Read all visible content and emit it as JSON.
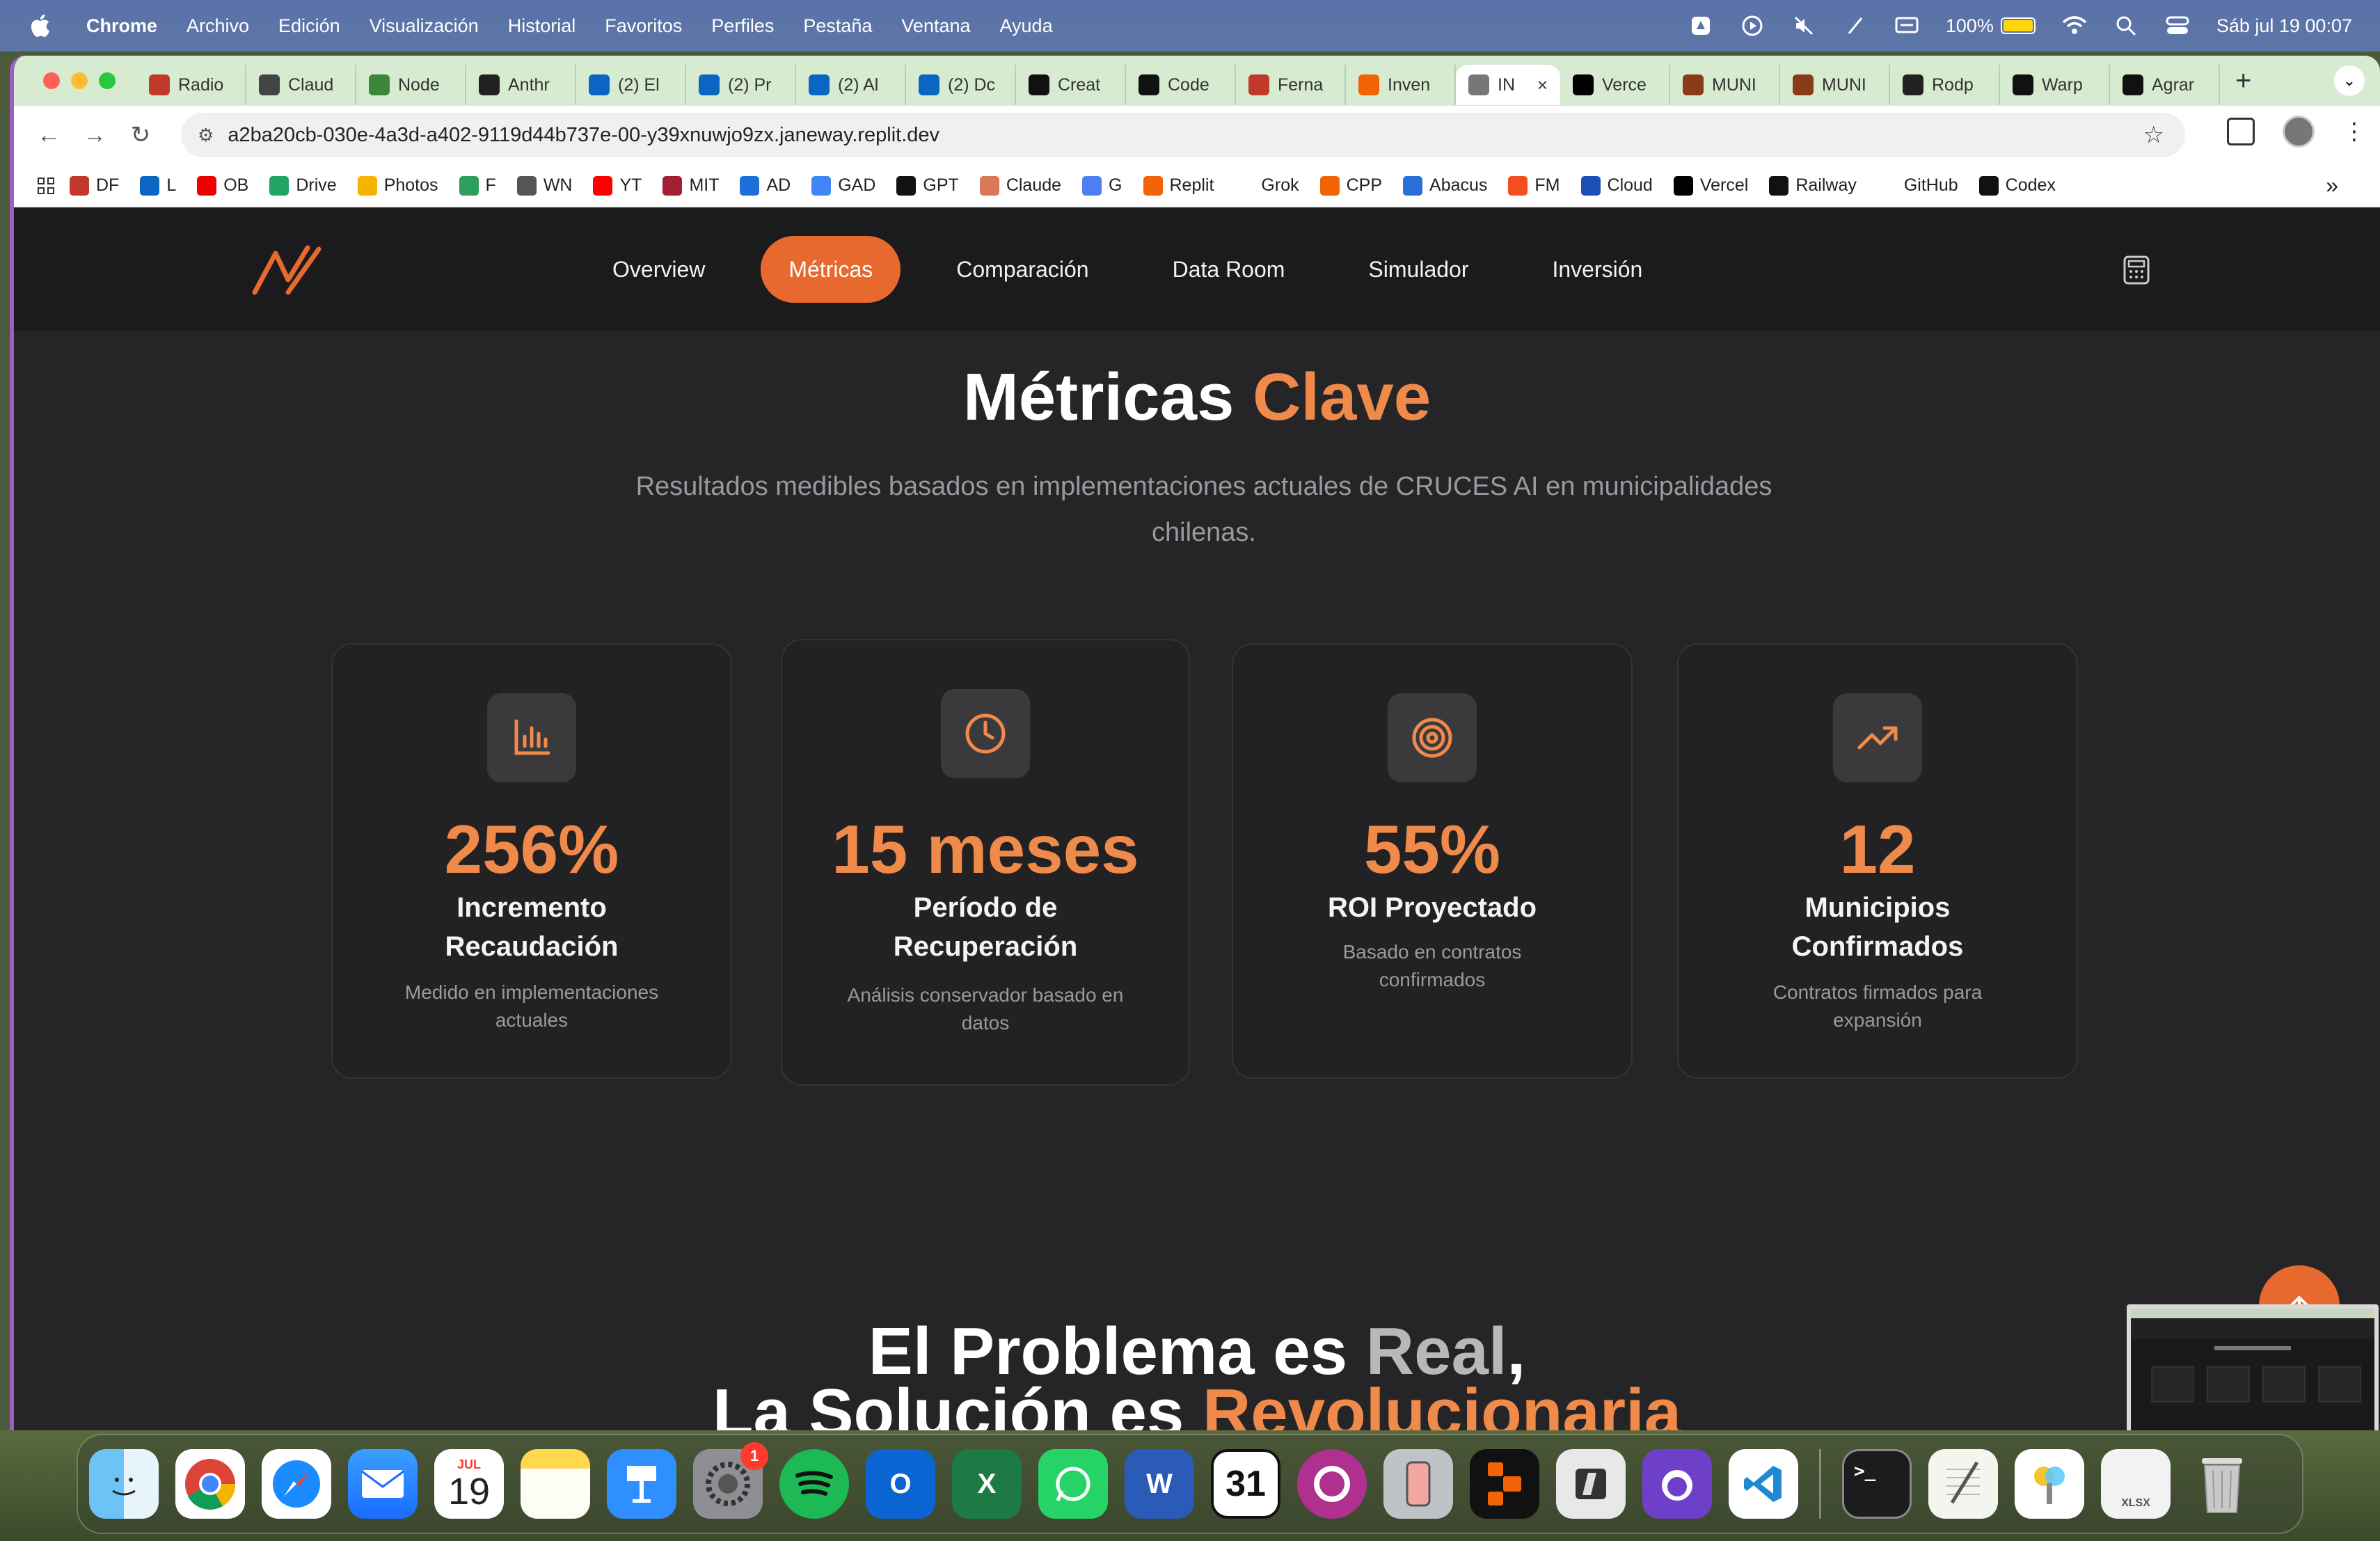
{
  "menubar": {
    "app": "Chrome",
    "items": [
      "Archivo",
      "Edición",
      "Visualización",
      "Historial",
      "Favoritos",
      "Perfiles",
      "Pestaña",
      "Ventana",
      "Ayuda"
    ],
    "battery": "100%",
    "datetime": "Sáb jul 19  00:07"
  },
  "tabs": [
    {
      "label": "Radio",
      "icon": "df-icon",
      "color": "#c0392b"
    },
    {
      "label": "Claud",
      "icon": "anthropic-icon",
      "color": "#444444"
    },
    {
      "label": "Node",
      "icon": "node-icon",
      "color": "#3c873a"
    },
    {
      "label": "Anthr",
      "icon": "anthropic-icon",
      "color": "#222222"
    },
    {
      "label": "(2) El",
      "icon": "linkedin-icon",
      "color": "#0a66c2"
    },
    {
      "label": "(2) Pr",
      "icon": "linkedin-icon",
      "color": "#0a66c2"
    },
    {
      "label": "(2) Al",
      "icon": "linkedin-icon",
      "color": "#0a66c2"
    },
    {
      "label": "(2) Dc",
      "icon": "linkedin-icon",
      "color": "#0a66c2"
    },
    {
      "label": "Creat",
      "icon": "v0-icon",
      "color": "#111111"
    },
    {
      "label": "Code",
      "icon": "openai-icon",
      "color": "#111111"
    },
    {
      "label": "Ferna",
      "icon": "df-icon",
      "color": "#c0392b"
    },
    {
      "label": "Inven",
      "icon": "replit-icon",
      "color": "#f26207"
    },
    {
      "label": "IN",
      "icon": "globe-icon",
      "color": "#777777",
      "active": true
    },
    {
      "label": "Verce",
      "icon": "vercel-icon",
      "color": "#000000"
    },
    {
      "label": "MUNI",
      "icon": "muni-icon",
      "color": "#8b3a1a"
    },
    {
      "label": "MUNI",
      "icon": "muni-icon",
      "color": "#8b3a1a"
    },
    {
      "label": "Rodp",
      "icon": "github-icon",
      "color": "#222222"
    },
    {
      "label": "Warp",
      "icon": "warp-icon",
      "color": "#111111"
    },
    {
      "label": "Agrar",
      "icon": "openai-icon",
      "color": "#111111"
    }
  ],
  "url": "a2ba20cb-030e-4a3d-a402-9119d44b737e-00-y39xnuwjo9zx.janeway.replit.dev",
  "bookmarks": [
    {
      "label": "DF",
      "icon": "df-icon",
      "color": "#c0392b"
    },
    {
      "label": "L",
      "icon": "linkedin-icon",
      "color": "#0a66c2"
    },
    {
      "label": "OB",
      "icon": "santander-icon",
      "color": "#ec0000"
    },
    {
      "label": "Drive",
      "icon": "drive-icon",
      "color": "#1fa463"
    },
    {
      "label": "Photos",
      "icon": "photos-icon",
      "color": "#f4b400"
    },
    {
      "label": "F",
      "icon": "f-icon",
      "color": "#2e9e5b"
    },
    {
      "label": "WN",
      "icon": "wn-icon",
      "color": "#555555"
    },
    {
      "label": "YT",
      "icon": "youtube-icon",
      "color": "#ff0000"
    },
    {
      "label": "MIT",
      "icon": "mit-icon",
      "color": "#a31f34"
    },
    {
      "label": "AD",
      "icon": "ad-icon",
      "color": "#1e6fd9"
    },
    {
      "label": "GAD",
      "icon": "google-icon",
      "color": "#4285f4"
    },
    {
      "label": "GPT",
      "icon": "openai-icon",
      "color": "#111111"
    },
    {
      "label": "Claude",
      "icon": "claude-icon",
      "color": "#d97757"
    },
    {
      "label": "G",
      "icon": "gemini-icon",
      "color": "#4f7df3"
    },
    {
      "label": "Replit",
      "icon": "replit-icon",
      "color": "#f26207"
    },
    {
      "label": "Grok",
      "icon": "grok-icon",
      "color": "#ffffff"
    },
    {
      "label": "CPP",
      "icon": "cpp-icon",
      "color": "#f26207"
    },
    {
      "label": "Abacus",
      "icon": "abacus-icon",
      "color": "#2a6fd6"
    },
    {
      "label": "FM",
      "icon": "figma-icon",
      "color": "#f24e1e"
    },
    {
      "label": "Cloud",
      "icon": "cloud-icon",
      "color": "#1a4fb5"
    },
    {
      "label": "Vercel",
      "icon": "vercel-icon",
      "color": "#000000"
    },
    {
      "label": "Railway",
      "icon": "railway-icon",
      "color": "#111111"
    },
    {
      "label": "GitHub",
      "icon": "github-icon",
      "color": "#ffffff"
    },
    {
      "label": "Codex",
      "icon": "openai-icon",
      "color": "#111111"
    }
  ],
  "site": {
    "nav": [
      "Overview",
      "Métricas",
      "Comparación",
      "Data Room",
      "Simulador",
      "Inversión"
    ],
    "active_nav": "Métricas",
    "title_main": "Métricas ",
    "title_accent": "Clave",
    "subtitle": "Resultados medibles basados en implementaciones actuales de CRUCES AI en municipalidades chilenas.",
    "cards": [
      {
        "icon": "bar-chart-icon",
        "value": "256%",
        "label": "Incremento Recaudación",
        "desc": "Medido en implementaciones actuales"
      },
      {
        "icon": "clock-icon",
        "value": "15 meses",
        "label": "Período de Recuperación",
        "desc": "Análisis conservador basado en datos"
      },
      {
        "icon": "target-icon",
        "value": "55%",
        "label": "ROI Proyectado",
        "desc": "Basado en contratos confirmados"
      },
      {
        "icon": "trending-up-icon",
        "value": "12",
        "label": "Municipios Confirmados",
        "desc": "Contratos firmados para expansión"
      }
    ],
    "section2": {
      "line1_a": "El Problema es ",
      "line1_b": "Real",
      "line1_c": ",",
      "line2_a": "La Solución es ",
      "line2_b": "Revolucionaria"
    },
    "accent_color": "#f08a4b",
    "brand_orange": "#e8692e"
  },
  "dock": {
    "calendar_month": "JUL",
    "calendar_day": "19",
    "settings_badge": "1",
    "calendar2_day": "31",
    "xlsx_label": "XLSX",
    "apps": [
      "Finder",
      "Chrome",
      "Safari",
      "Mail",
      "Calendar",
      "Notes",
      "Keynote",
      "System Settings",
      "Spotify",
      "Outlook",
      "Excel",
      "WhatsApp",
      "Word",
      "Calendar 31",
      "Screen Recorder",
      "iPhone Mirroring",
      "Replit",
      "Parallels",
      "GitHub Desktop",
      "VS Code",
      "Terminal",
      "TextEdit",
      "Passwords",
      "XLSX file",
      "Trash"
    ]
  }
}
